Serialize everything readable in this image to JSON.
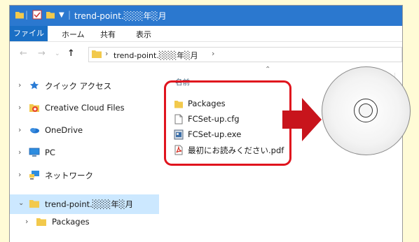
{
  "window": {
    "title": "trend-point.░░░年░月"
  },
  "ribbon": {
    "tabs": [
      "ファイル",
      "ホーム",
      "共有",
      "表示"
    ]
  },
  "address_bar": {
    "path": "trend-point.░░░年░月"
  },
  "sidebar": {
    "items": [
      {
        "label": "クイック アクセス",
        "icon": "star-icon"
      },
      {
        "label": "Creative Cloud Files",
        "icon": "creative-cloud-icon"
      },
      {
        "label": "OneDrive",
        "icon": "onedrive-icon"
      },
      {
        "label": "PC",
        "icon": "pc-icon"
      },
      {
        "label": "ネットワーク",
        "icon": "network-icon"
      },
      {
        "label": "trend-point.░░░年░月",
        "icon": "folder-icon",
        "selected": true
      },
      {
        "label": "Packages",
        "icon": "folder-icon"
      }
    ]
  },
  "content": {
    "column_header": "名前",
    "files": [
      {
        "name": "Packages",
        "icon": "folder-icon"
      },
      {
        "name": "FCSet-up.cfg",
        "icon": "file-icon"
      },
      {
        "name": "FCSet-up.exe",
        "icon": "exe-icon"
      },
      {
        "name": "最初にお読みください.pdf",
        "icon": "pdf-icon"
      }
    ]
  },
  "colors": {
    "background": "#fffbd6",
    "titlebar": "#2b78cf",
    "highlight": "#e0141e",
    "arrow": "#c8141c",
    "selection": "#cce8ff"
  }
}
